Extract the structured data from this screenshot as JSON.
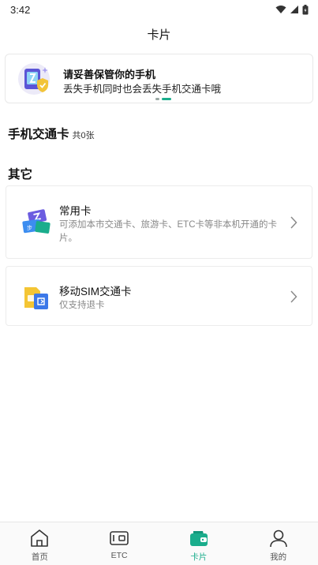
{
  "status_bar": {
    "time": "3:42"
  },
  "nav": {
    "title": "卡片"
  },
  "banner": {
    "title": "请妥善保管你的手机",
    "subtitle": "丢失手机同时也会丢失手机交通卡哦"
  },
  "transit_section": {
    "title": "手机交通卡",
    "count": "共0张"
  },
  "other_section": {
    "title": "其它"
  },
  "cards": [
    {
      "title": "常用卡",
      "description": "可添加本市交通卡、旅游卡、ETC卡等非本机开通的卡片。"
    },
    {
      "title": "移动SIM交通卡",
      "description": "仅支持退卡"
    }
  ],
  "tabbar": {
    "items": [
      {
        "label": "首页",
        "icon": "home-icon"
      },
      {
        "label": "ETC",
        "icon": "etc-icon"
      },
      {
        "label": "卡片",
        "icon": "wallet-icon"
      },
      {
        "label": "我的",
        "icon": "user-icon"
      }
    ],
    "active": "卡片"
  },
  "colors": {
    "accent": "#1aad8c"
  }
}
